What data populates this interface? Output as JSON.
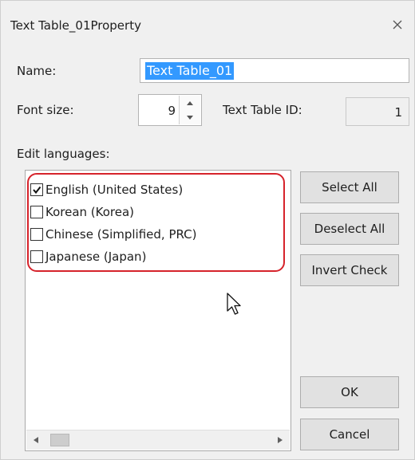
{
  "window": {
    "title": "Text Table_01Property",
    "close_icon": "close-icon"
  },
  "form": {
    "name_label": "Name:",
    "name_value": "Text Table_01",
    "font_size_label": "Font size:",
    "font_size_value": "9",
    "table_id_label": "Text Table ID:",
    "table_id_value": "1",
    "edit_languages_label": "Edit languages:"
  },
  "languages": [
    {
      "label": "English (United States)",
      "checked": true
    },
    {
      "label": "Korean (Korea)",
      "checked": false
    },
    {
      "label": "Chinese (Simplified, PRC)",
      "checked": false
    },
    {
      "label": "Japanese (Japan)",
      "checked": false
    }
  ],
  "buttons": {
    "select_all": "Select All",
    "deselect_all": "Deselect All",
    "invert_check": "Invert Check",
    "ok": "OK",
    "cancel": "Cancel"
  },
  "colors": {
    "highlight": "#d6232b",
    "selection": "#3399ff"
  }
}
